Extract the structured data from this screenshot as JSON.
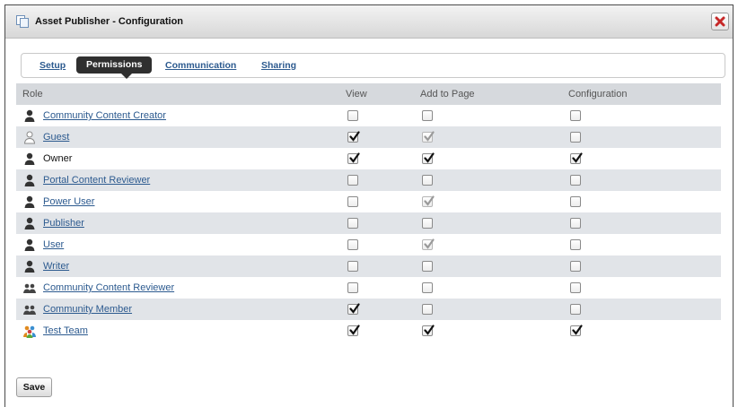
{
  "window": {
    "title": "Asset Publisher - Configuration"
  },
  "tabs": [
    {
      "label": "Setup",
      "active": false
    },
    {
      "label": "Permissions",
      "active": true
    },
    {
      "label": "Communication",
      "active": false
    },
    {
      "label": "Sharing",
      "active": false
    }
  ],
  "table": {
    "headers": [
      "Role",
      "View",
      "Add to Page",
      "Configuration"
    ],
    "rows": [
      {
        "role": "Community Content Creator",
        "icon": "user-icon",
        "link": true,
        "view": false,
        "add": false,
        "add_disabled": false,
        "config": false
      },
      {
        "role": "Guest",
        "icon": "guest-user-icon",
        "link": true,
        "view": true,
        "add": true,
        "add_disabled": true,
        "config": false
      },
      {
        "role": "Owner",
        "icon": "user-icon",
        "link": false,
        "view": true,
        "add": true,
        "add_disabled": false,
        "config": true
      },
      {
        "role": "Portal Content Reviewer",
        "icon": "user-icon",
        "link": true,
        "view": false,
        "add": false,
        "add_disabled": false,
        "config": false
      },
      {
        "role": "Power User",
        "icon": "user-icon",
        "link": true,
        "view": false,
        "add": true,
        "add_disabled": true,
        "config": false
      },
      {
        "role": "Publisher",
        "icon": "user-icon",
        "link": true,
        "view": false,
        "add": false,
        "add_disabled": false,
        "config": false
      },
      {
        "role": "User",
        "icon": "user-icon",
        "link": true,
        "view": false,
        "add": true,
        "add_disabled": true,
        "config": false
      },
      {
        "role": "Writer",
        "icon": "user-icon",
        "link": true,
        "view": false,
        "add": false,
        "add_disabled": false,
        "config": false
      },
      {
        "role": "Community Content Reviewer",
        "icon": "group-icon",
        "link": true,
        "view": false,
        "add": false,
        "add_disabled": false,
        "config": false
      },
      {
        "role": "Community Member",
        "icon": "group-icon",
        "link": true,
        "view": true,
        "add": false,
        "add_disabled": false,
        "config": false
      },
      {
        "role": "Test Team",
        "icon": "team-icon",
        "link": true,
        "view": true,
        "add": true,
        "add_disabled": false,
        "config": true
      }
    ]
  },
  "buttons": {
    "save": "Save"
  },
  "colors": {
    "link": "#2c5a8f",
    "header_bg": "#d6d9dd",
    "alt_row": "#e1e4e8",
    "active_tab": "#2f2f2f",
    "close_x": "#c62828"
  }
}
